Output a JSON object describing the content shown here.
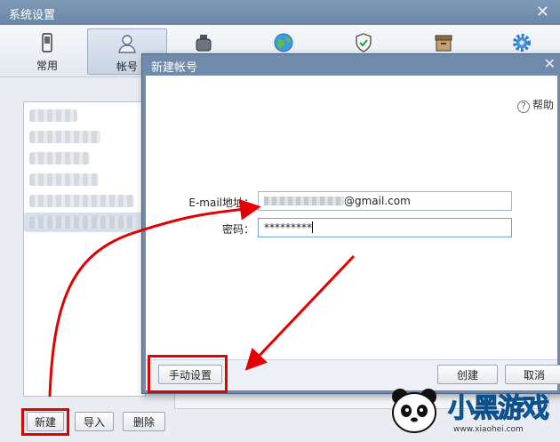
{
  "outer_window": {
    "title": "系统设置"
  },
  "toolbar": {
    "items": [
      {
        "label": "常用",
        "icon": "phone-icon"
      },
      {
        "label": "帐号",
        "icon": "person-icon"
      },
      {
        "label": "",
        "icon": "ink-bottle-icon"
      },
      {
        "label": "",
        "icon": "globe-icon"
      },
      {
        "label": "",
        "icon": "shield-check-icon"
      },
      {
        "label": "",
        "icon": "archive-box-icon"
      },
      {
        "label": "",
        "icon": "gear-icon"
      }
    ]
  },
  "account_panel": {
    "buttons": {
      "new": "新建",
      "import": "导入",
      "delete": "删除"
    }
  },
  "dialog": {
    "title": "新建帐号",
    "help": "帮助",
    "email_label": "E-mail地址：",
    "email_suffix": "@gmail.com",
    "password_label": "密码：",
    "password_value": "*********",
    "manual_button": "手动设置",
    "create_button": "创建",
    "cancel_button": "取消"
  },
  "watermark": {
    "brand": "小黑游戏",
    "url": "www.xiaohei.com"
  },
  "colors": {
    "annotation": "#e30000",
    "title_bar": "#6f8aab",
    "selection": "#c8d4e6"
  }
}
